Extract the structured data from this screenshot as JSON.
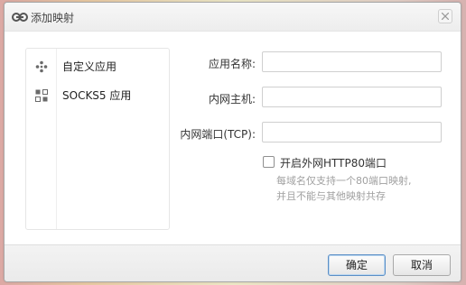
{
  "window": {
    "title": "添加映射",
    "icon": "link-icon",
    "close_icon": "close-icon"
  },
  "sidebar": {
    "items": [
      {
        "label": "自定义应用",
        "icon": "custom-app-icon"
      },
      {
        "label": "SOCKS5 应用",
        "icon": "grid-app-icon"
      }
    ]
  },
  "form": {
    "app_name_label": "应用名称:",
    "app_name_value": "",
    "host_label": "内网主机:",
    "host_value": "",
    "port_label": "内网端口(TCP):",
    "port_value": "",
    "http80_label": "开启外网HTTP80端口",
    "http80_checked": false,
    "note_line1": "每域名仅支持一个80端口映射,",
    "note_line2": "并且不能与其他映射共存"
  },
  "footer": {
    "ok_label": "确定",
    "cancel_label": "取消"
  },
  "colors": {
    "primary_button_border": "#5b8fc6",
    "note_text": "#a0a0a0"
  }
}
